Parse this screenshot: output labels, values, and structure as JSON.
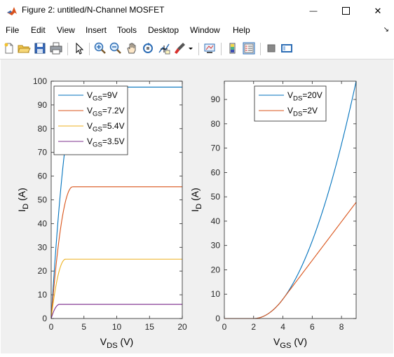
{
  "window": {
    "title": "Figure 2: untitled/N-Channel MOSFET",
    "minimize_glyph": "—",
    "maximize_glyph": "☐",
    "close_glyph": "✕"
  },
  "menu": {
    "items": [
      "File",
      "Edit",
      "View",
      "Insert",
      "Tools",
      "Desktop",
      "Window",
      "Help"
    ],
    "corner_glyph": "↘"
  },
  "toolbar": {
    "icons": [
      "new-figure-icon",
      "open-file-icon",
      "save-icon",
      "print-icon",
      "pointer-icon",
      "zoom-in-icon",
      "zoom-out-icon",
      "pan-hand-icon",
      "rotate-3d-icon",
      "data-cursor-icon",
      "brush-icon",
      "brush-dropdown-icon",
      "link-plot-icon",
      "colorbar-icon",
      "legend-icon",
      "hide-plot-tools-icon",
      "show-plot-tools-icon"
    ]
  },
  "colors": {
    "blue": "#0072BD",
    "orange": "#D95319",
    "yellow": "#EDB120",
    "purple": "#7E2F8E",
    "figure_bg": "#f0f0f0"
  },
  "chart_data": [
    {
      "type": "line",
      "xlabel_main": "V",
      "xlabel_sub": "DS",
      "xlabel_unit": " (V)",
      "ylabel_main": "I",
      "ylabel_sub": "D",
      "ylabel_unit": " (A)",
      "xlim": [
        0,
        20
      ],
      "ylim": [
        0,
        100
      ],
      "xticks": [
        0,
        5,
        10,
        15,
        20
      ],
      "yticks": [
        0,
        10,
        20,
        30,
        40,
        50,
        60,
        70,
        80,
        90,
        100
      ],
      "legend_position": "top-left",
      "series": [
        {
          "name_main": "V",
          "name_sub": "GS",
          "name_rest": "=9V",
          "color": "#0072BD",
          "vt": 2,
          "sat": 97.5
        },
        {
          "name_main": "V",
          "name_sub": "GS",
          "name_rest": "=7.2V",
          "color": "#D95319",
          "vt": 2,
          "sat": 55.5
        },
        {
          "name_main": "V",
          "name_sub": "GS",
          "name_rest": "=5.4V",
          "color": "#EDB120",
          "vt": 2,
          "sat": 25
        },
        {
          "name_main": "V",
          "name_sub": "GS",
          "name_rest": "=3.5V",
          "color": "#7E2F8E",
          "vt": 2,
          "sat": 6
        }
      ]
    },
    {
      "type": "line",
      "xlabel_main": "V",
      "xlabel_sub": "GS",
      "xlabel_unit": " (V)",
      "ylabel_main": "I",
      "ylabel_sub": "D",
      "ylabel_unit": " (A)",
      "xlim": [
        0,
        9
      ],
      "ylim": [
        0,
        97.5
      ],
      "xticks": [
        0,
        2,
        4,
        6,
        8
      ],
      "yticks": [
        0,
        10,
        20,
        30,
        40,
        50,
        60,
        70,
        80,
        90
      ],
      "legend_position": "top-center",
      "series": [
        {
          "name_main": "V",
          "name_sub": "DS",
          "name_rest": "=20V",
          "color": "#0072BD",
          "vds": 20
        },
        {
          "name_main": "V",
          "name_sub": "DS",
          "name_rest": "=2V",
          "color": "#D95319",
          "vds": 2
        }
      ]
    }
  ]
}
